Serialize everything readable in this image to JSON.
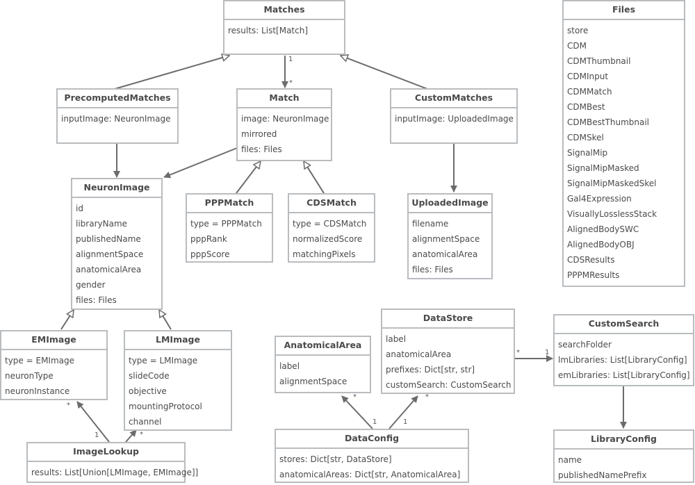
{
  "diagram": {
    "type": "uml-class-diagram",
    "classes": {
      "matches": {
        "name": "Matches",
        "attributes": [
          "results: List[Match]"
        ]
      },
      "precomputed_matches": {
        "name": "PrecomputedMatches",
        "attributes": [
          "inputImage: NeuronImage"
        ]
      },
      "match": {
        "name": "Match",
        "attributes": [
          "image: NeuronImage",
          "mirrored",
          "files: Files"
        ]
      },
      "custom_matches": {
        "name": "CustomMatches",
        "attributes": [
          "inputImage: UploadedImage"
        ]
      },
      "files": {
        "name": "Files",
        "attributes": [
          "store",
          "CDM",
          "CDMThumbnail",
          "CDMInput",
          "CDMMatch",
          "CDMBest",
          "CDMBestThumbnail",
          "CDMSkel",
          "SignalMip",
          "SignalMipMasked",
          "SignalMipMaskedSkel",
          "Gal4Expression",
          "VisuallyLosslessStack",
          "AlignedBodySWC",
          "AlignedBodyOBJ",
          "CDSResults",
          "PPPMResults"
        ]
      },
      "neuron_image": {
        "name": "NeuronImage",
        "attributes": [
          "id",
          "libraryName",
          "publishedName",
          "alignmentSpace",
          "anatomicalArea",
          "gender",
          "files: Files"
        ]
      },
      "ppp_match": {
        "name": "PPPMatch",
        "attributes": [
          "type = PPPMatch",
          "pppRank",
          "pppScore"
        ]
      },
      "cds_match": {
        "name": "CDSMatch",
        "attributes": [
          "type = CDSMatch",
          "normalizedScore",
          "matchingPixels"
        ]
      },
      "uploaded_image": {
        "name": "UploadedImage",
        "attributes": [
          "filename",
          "alignmentSpace",
          "anatomicalArea",
          "files: Files"
        ]
      },
      "em_image": {
        "name": "EMImage",
        "attributes": [
          "type = EMImage",
          "neuronType",
          "neuronInstance"
        ]
      },
      "lm_image": {
        "name": "LMImage",
        "attributes": [
          "type = LMImage",
          "slideCode",
          "objective",
          "mountingProtocol",
          "channel"
        ]
      },
      "image_lookup": {
        "name": "ImageLookup",
        "attributes": [
          "results: List[Union[LMImage, EMImage]]"
        ]
      },
      "anatomical_area": {
        "name": "AnatomicalArea",
        "attributes": [
          "label",
          "alignmentSpace"
        ]
      },
      "data_store": {
        "name": "DataStore",
        "attributes": [
          "label",
          "anatomicalArea",
          "prefixes: Dict[str, str]",
          "customSearch: CustomSearch"
        ]
      },
      "data_config": {
        "name": "DataConfig",
        "attributes": [
          "stores: Dict[str, DataStore]",
          "anatomicalAreas: Dict[str, AnatomicalArea]"
        ]
      },
      "custom_search": {
        "name": "CustomSearch",
        "attributes": [
          "searchFolder",
          "lmLibraries: List[LibraryConfig]",
          "emLibraries: List[LibraryConfig]"
        ]
      },
      "library_config": {
        "name": "LibraryConfig",
        "attributes": [
          "name",
          "publishedNamePrefix"
        ]
      }
    },
    "relationships": [
      {
        "from": "precomputed_matches",
        "to": "matches",
        "kind": "inheritance"
      },
      {
        "from": "custom_matches",
        "to": "matches",
        "kind": "inheritance"
      },
      {
        "from": "matches",
        "to": "match",
        "kind": "association",
        "from_mult": "1",
        "to_mult": "*"
      },
      {
        "from": "precomputed_matches",
        "to": "neuron_image",
        "kind": "association"
      },
      {
        "from": "match",
        "to": "neuron_image",
        "kind": "association"
      },
      {
        "from": "ppp_match",
        "to": "match",
        "kind": "inheritance"
      },
      {
        "from": "cds_match",
        "to": "match",
        "kind": "inheritance"
      },
      {
        "from": "custom_matches",
        "to": "uploaded_image",
        "kind": "association"
      },
      {
        "from": "em_image",
        "to": "neuron_image",
        "kind": "inheritance"
      },
      {
        "from": "lm_image",
        "to": "neuron_image",
        "kind": "inheritance"
      },
      {
        "from": "image_lookup",
        "to": "em_image",
        "kind": "association",
        "from_mult": "1",
        "to_mult": "*"
      },
      {
        "from": "image_lookup",
        "to": "lm_image",
        "kind": "association",
        "to_mult": "*"
      },
      {
        "from": "data_config",
        "to": "anatomical_area",
        "kind": "association",
        "from_mult": "1",
        "to_mult": "*"
      },
      {
        "from": "data_config",
        "to": "data_store",
        "kind": "association",
        "from_mult": "1",
        "to_mult": "*"
      },
      {
        "from": "data_store",
        "to": "custom_search",
        "kind": "association",
        "from_mult": "*",
        "to_mult": "1"
      },
      {
        "from": "custom_search",
        "to": "library_config",
        "kind": "association"
      }
    ]
  },
  "colors": {
    "border": "#b9bcbf",
    "line": "#6b6b6b",
    "text": "#4a4a4a"
  }
}
